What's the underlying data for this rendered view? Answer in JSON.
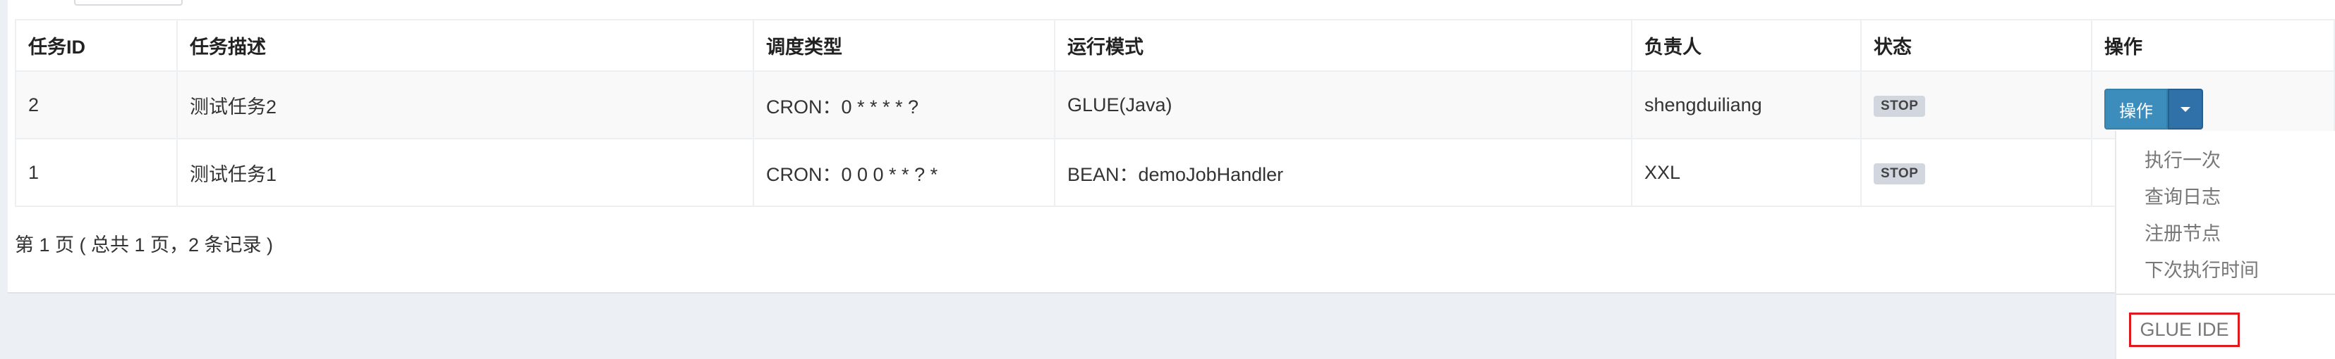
{
  "table": {
    "headers": [
      "任务ID",
      "任务描述",
      "调度类型",
      "运行模式",
      "负责人",
      "状态",
      "操作"
    ],
    "rows": [
      {
        "id": "2",
        "desc": "测试任务2",
        "schedule": "CRON：0 * * * * ?",
        "mode": "GLUE(Java)",
        "owner": "shengduiliang",
        "status": "STOP"
      },
      {
        "id": "1",
        "desc": "测试任务1",
        "schedule": "CRON：0 0 0 * * ? *",
        "mode": "BEAN：demoJobHandler",
        "owner": "XXL",
        "status": "STOP"
      }
    ]
  },
  "actions": {
    "button_label": "操作"
  },
  "pager": {
    "text": "第 1 页 ( 总共 1 页，2 条记录 )"
  },
  "dropdown": {
    "items": [
      "执行一次",
      "查询日志",
      "注册节点",
      "下次执行时间"
    ],
    "glue_ide": "GLUE IDE"
  },
  "colors": {
    "primary_button": "#3c8dbc",
    "highlight_border": "#e0191f",
    "status_tag": "#d2d6de"
  }
}
